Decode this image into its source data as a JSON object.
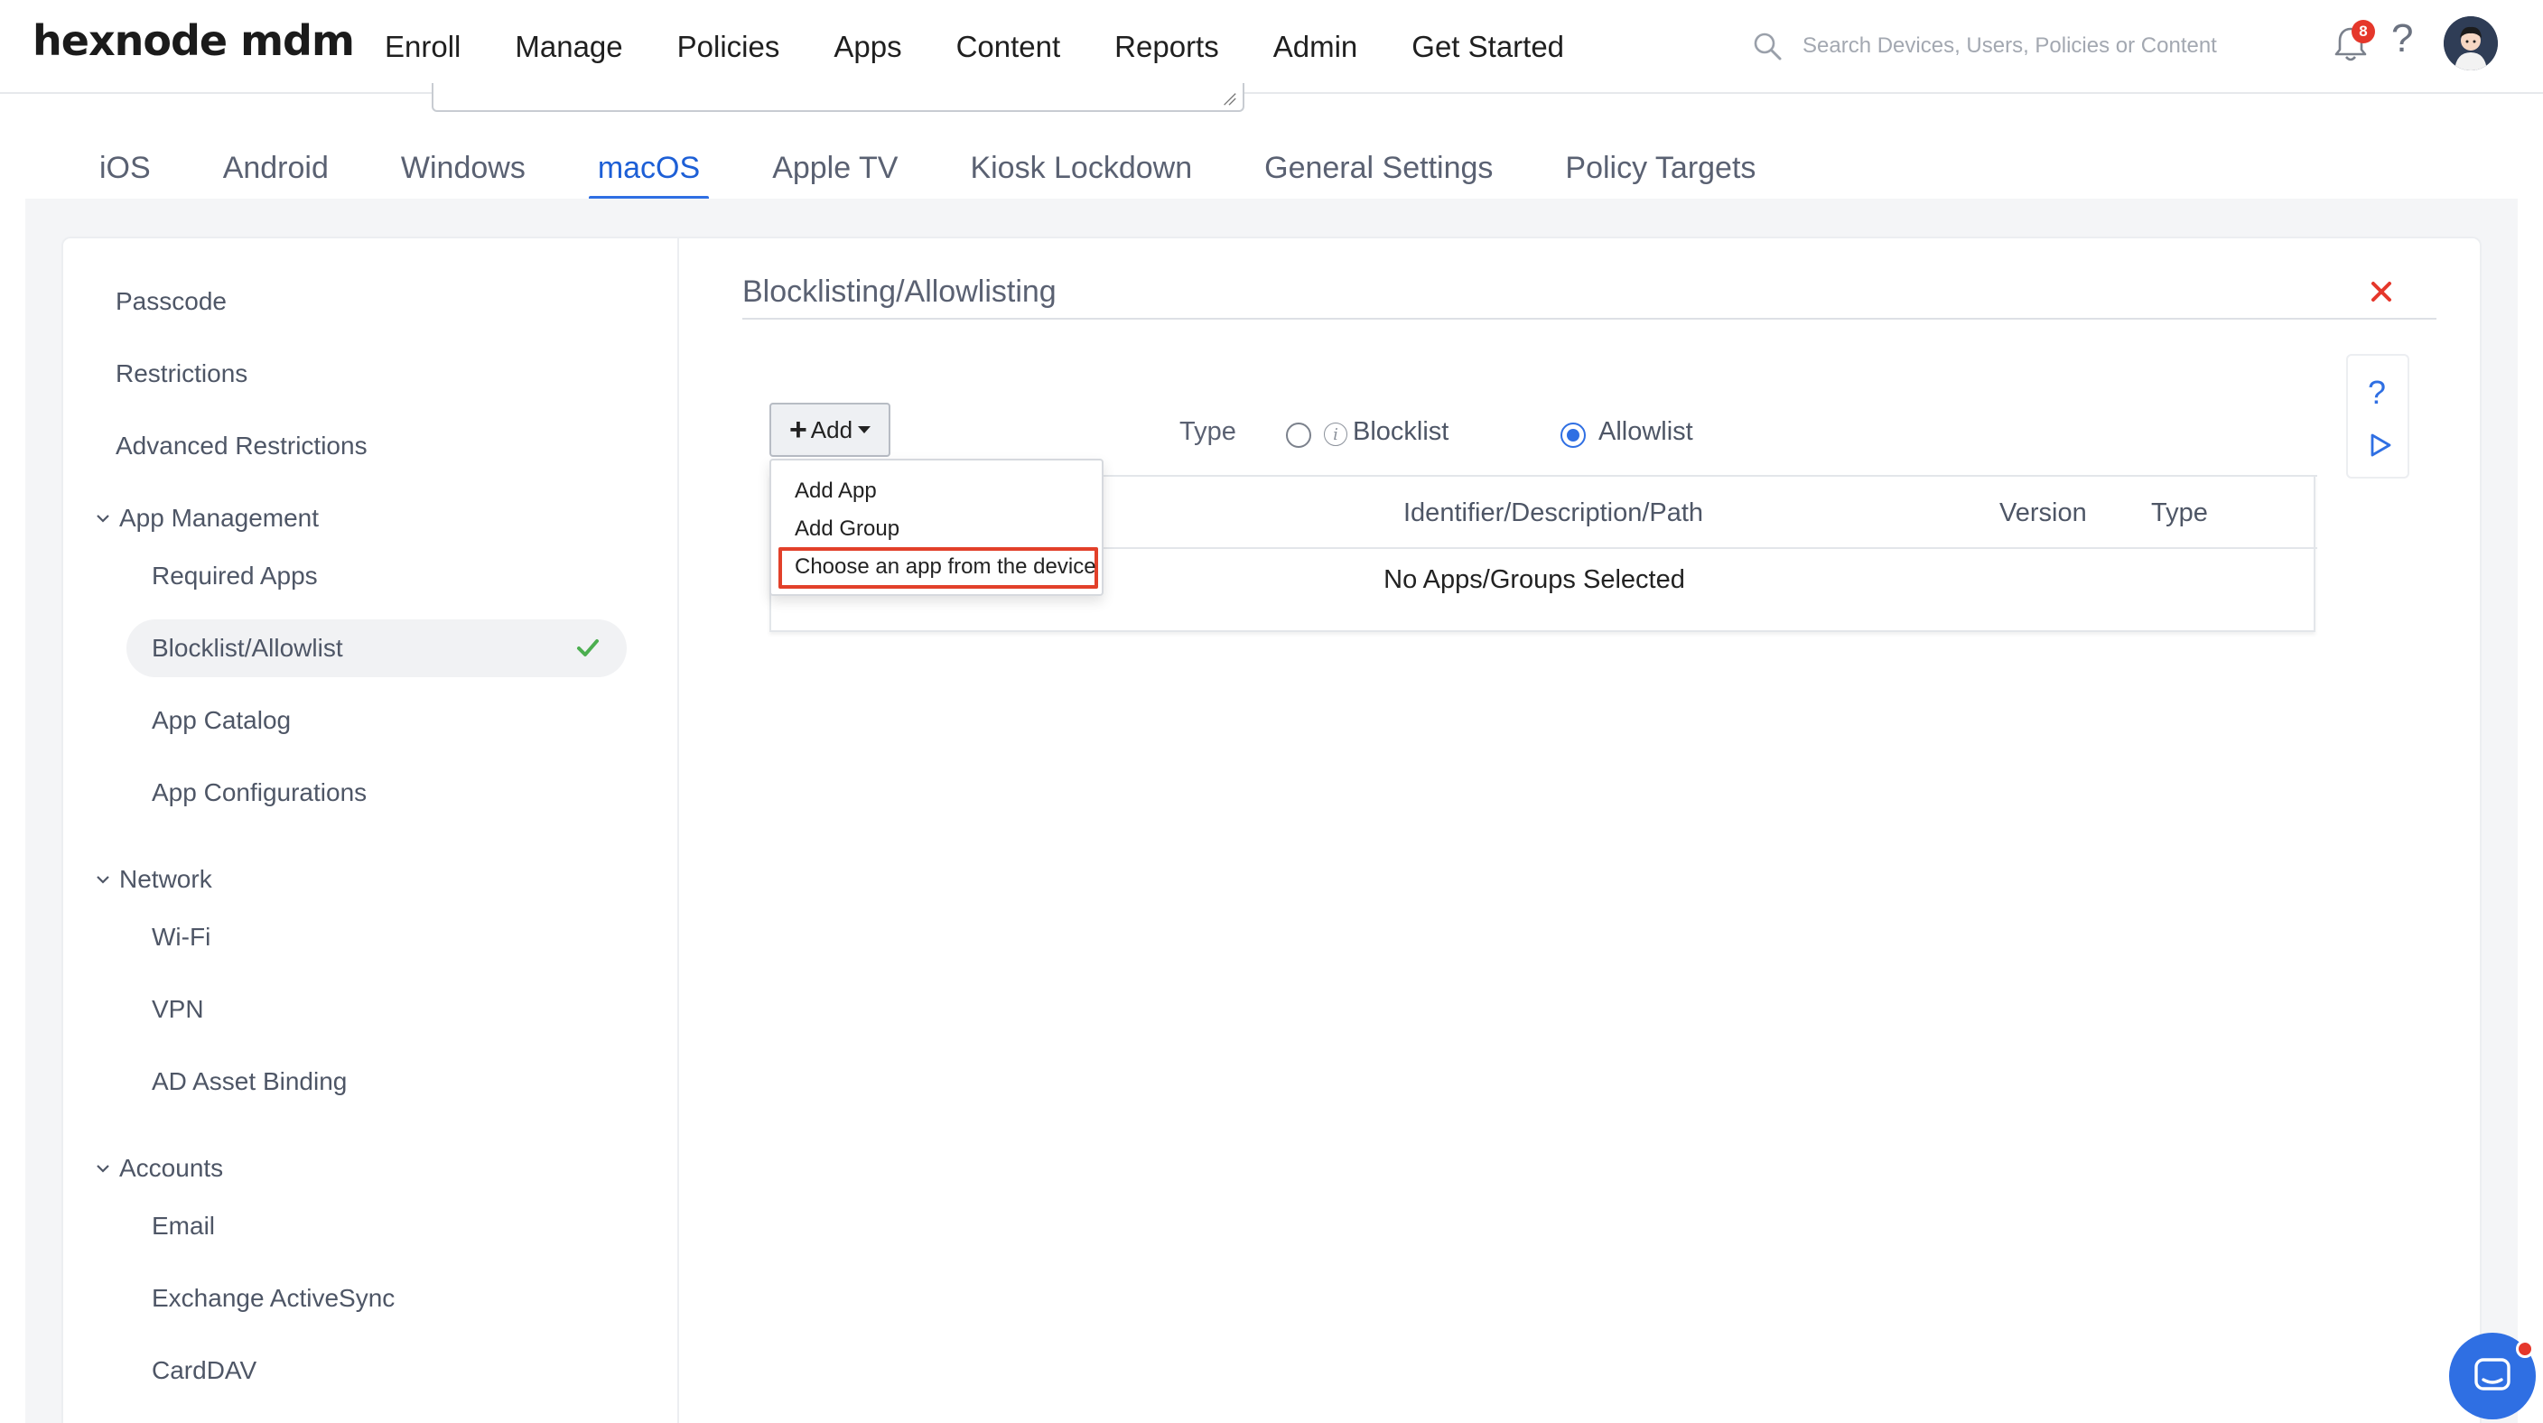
{
  "brand": {
    "logo_text": "hexnode mdm",
    "accent": "#2f6fe3",
    "danger": "#e5372b"
  },
  "topnav": {
    "items": [
      {
        "label": "Enroll"
      },
      {
        "label": "Manage"
      },
      {
        "label": "Policies",
        "active": true
      },
      {
        "label": "Apps"
      },
      {
        "label": "Content"
      },
      {
        "label": "Reports"
      },
      {
        "label": "Admin"
      },
      {
        "label": "Get Started"
      }
    ],
    "search_placeholder": "Search Devices, Users, Policies or Content",
    "notification_count": "8",
    "help_glyph": "?",
    "icons": [
      "search-icon",
      "bell-icon",
      "help-icon",
      "user-avatar"
    ]
  },
  "platform_tabs": [
    {
      "label": "iOS"
    },
    {
      "label": "Android"
    },
    {
      "label": "Windows"
    },
    {
      "label": "macOS",
      "active": true
    },
    {
      "label": "Apple TV"
    },
    {
      "label": "Kiosk Lockdown"
    },
    {
      "label": "General Settings"
    },
    {
      "label": "Policy Targets"
    }
  ],
  "sidebar": {
    "top_items": [
      "Passcode",
      "Restrictions",
      "Advanced Restrictions"
    ],
    "groups": [
      {
        "label": "App Management",
        "items": [
          "Required Apps",
          "Blocklist/Allowlist",
          "App Catalog",
          "App Configurations"
        ]
      },
      {
        "label": "Network",
        "items": [
          "Wi-Fi",
          "VPN",
          "AD Asset Binding"
        ]
      },
      {
        "label": "Accounts",
        "items": [
          "Email",
          "Exchange ActiveSync",
          "CardDAV"
        ]
      }
    ],
    "active_item": "Blocklist/Allowlist"
  },
  "panel": {
    "title": "Blocklisting/Allowlisting",
    "add_button_label": "Add",
    "type_label": "Type",
    "type_options": [
      {
        "label": "Blocklist",
        "selected": false
      },
      {
        "label": "Allowlist",
        "selected": true
      }
    ],
    "add_menu": [
      "Add App",
      "Add Group",
      "Choose an app from the device"
    ],
    "highlighted_menu_item": "Choose an app from the device",
    "table": {
      "columns": [
        "Identifier/Description/Path",
        "Version",
        "Type"
      ],
      "empty_text": "No Apps/Groups Selected"
    },
    "side_tools": {
      "help_glyph": "?"
    }
  }
}
